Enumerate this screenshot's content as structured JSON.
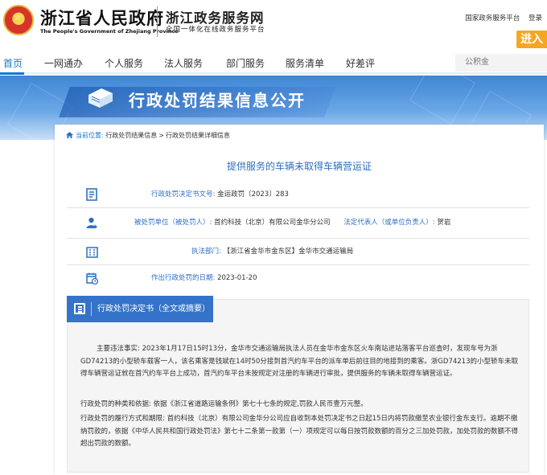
{
  "header": {
    "site_title": "浙江省人民政府",
    "site_subtitle": "The People's Government of Zhejiang Province",
    "zw_title": "浙江政务服务网",
    "zw_subtitle": "全国一体化在线政务服务平台",
    "top_links": [
      "国家政务服务平台",
      "登录"
    ],
    "enter_label": "进入",
    "emblem_icon": "national-emblem-icon"
  },
  "nav": {
    "items": [
      "首页",
      "一网通办",
      "个人服务",
      "法人服务",
      "部门服务",
      "服务清单",
      "好差评"
    ],
    "active_index": 0,
    "search_placeholder": "公积金",
    "active_color": "#1677d2"
  },
  "banner": {
    "title": "行政处罚结果信息公开",
    "icon": "book-icon",
    "color": "#3f86d4"
  },
  "breadcrumb": {
    "here": "当前位置:",
    "items": [
      "行政处罚结果信息",
      "行政处罚结果详细信息"
    ],
    "separator": ">"
  },
  "page_title": "提供服务的车辆未取得车辆营运证",
  "info": {
    "doc_no_label": "行政处罚决定书文号:",
    "doc_no": "金运政罚〔2023〕283",
    "party_label": "被处罚单位（被处罚人）:",
    "party": "首约科技（北京）有限公司金华分公司",
    "legal_rep_label": "法定代表人（或单位负责人）:",
    "legal_rep": "贺岩",
    "dept_label": "执法部门:",
    "dept": "【浙江省金华市金东区】金华市交通运输局",
    "date_label": "作出行政处罚的日期:",
    "date": "2023-01-20"
  },
  "decision": {
    "section_title": "行政处罚决定书（全文或摘要）",
    "p1": "主要违法事实: 2023年1月17日15时13分，金华市交通运输局执法人员在金华市金东区火车南站进站落客平台巡查时，发现车号为浙GD74213的小型轿车载客一人，该名乘客是钱斌在14时50分接到首汽约车平台的派车单后前往目的地接到的乘客。浙GD74213的小型轿车未取得车辆营运证就在首汽约车平台上成功，首汽约车平台未按规定对注册的车辆进行审批，提供服务的车辆未取得车辆营运证。",
    "p2": "行政处罚的种类和依据: 依据《浙江省道路运输条例》第七十七条的规定,罚款人民币壹万元整。",
    "p3": "行政处罚的履行方式和期限: 首约科技（北京）有限公司金华分公司应自收到本处罚决定书之日起15日内将罚款缴至农业银行金东支行。逾期不缴纳罚款的，依据《中华人民共和国行政处罚法》第七十二条第一款第（一）项规定可以每日按罚款数额的百分之三加处罚款，加处罚款的数额不得超出罚款的数额。",
    "accent_color": "#3473c9"
  }
}
